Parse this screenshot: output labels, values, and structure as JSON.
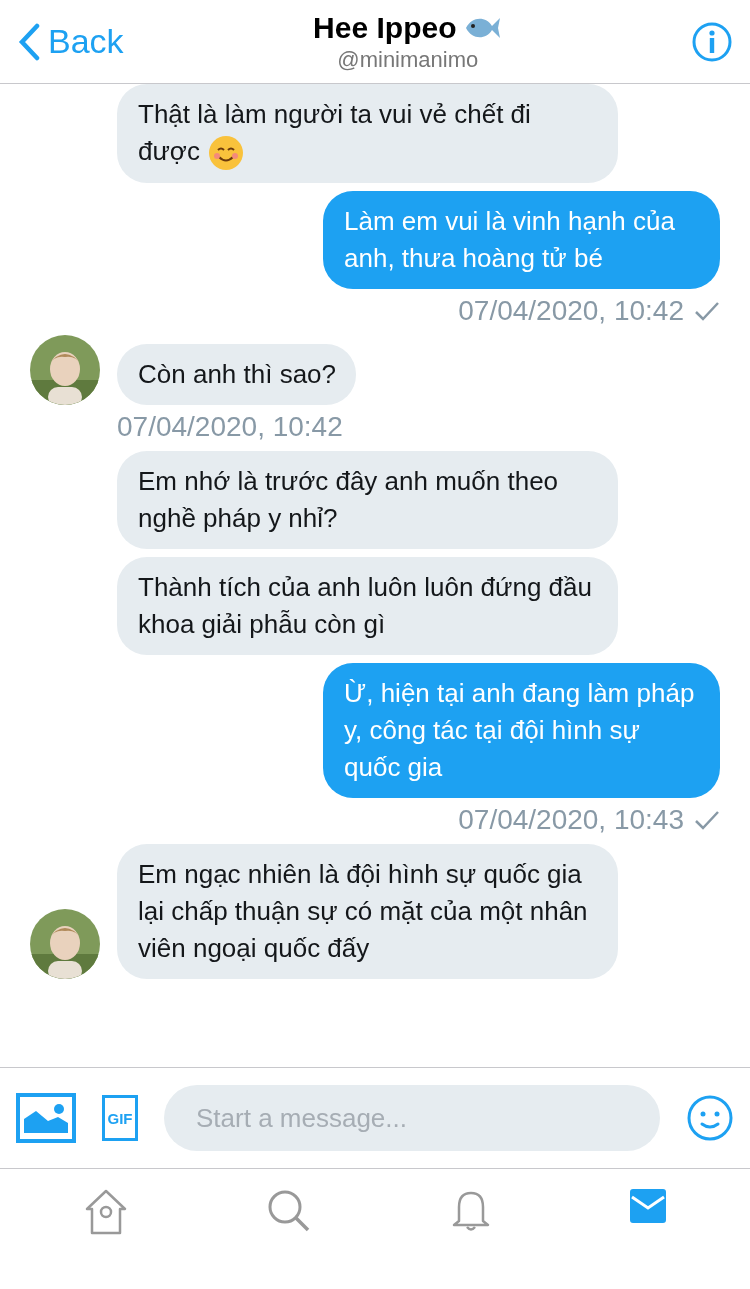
{
  "header": {
    "back": "Back",
    "name": "Hee Ippeo",
    "handle": "@minimanimo"
  },
  "messages": [
    {
      "kind": "received",
      "text": "Thật là làm người ta vui vẻ chết đi được",
      "smiley": true,
      "avatar": false
    },
    {
      "kind": "sent",
      "text": "Làm em vui là vinh hạnh của anh, thưa hoàng tử bé",
      "timestamp": "07/04/2020, 10:42",
      "read": true
    },
    {
      "kind": "received",
      "text": "Còn anh thì sao?",
      "avatar": true,
      "timestamp": "07/04/2020, 10:42"
    },
    {
      "kind": "received",
      "text": "Em nhớ là trước đây anh muốn theo nghề pháp y nhỉ?",
      "avatar": false
    },
    {
      "kind": "received",
      "text": "Thành tích của anh luôn luôn đứng đầu khoa giải phẫu còn gì",
      "avatar": false
    },
    {
      "kind": "sent",
      "text": "Ừ, hiện tại anh đang làm pháp y, công tác tại đội hình sự quốc gia",
      "timestamp": "07/04/2020, 10:43",
      "read": true
    },
    {
      "kind": "received",
      "text": "Em ngạc nhiên là đội hình sự quốc gia lại chấp thuận sự có mặt của một nhân viên ngoại quốc đấy",
      "avatar": true
    }
  ],
  "composer": {
    "placeholder": "Start a message...",
    "gif": "GIF"
  },
  "tabs": [
    {
      "kind": "home",
      "selected": false
    },
    {
      "kind": "search",
      "selected": false
    },
    {
      "kind": "bell",
      "selected": false
    },
    {
      "kind": "mail",
      "selected": true
    }
  ]
}
